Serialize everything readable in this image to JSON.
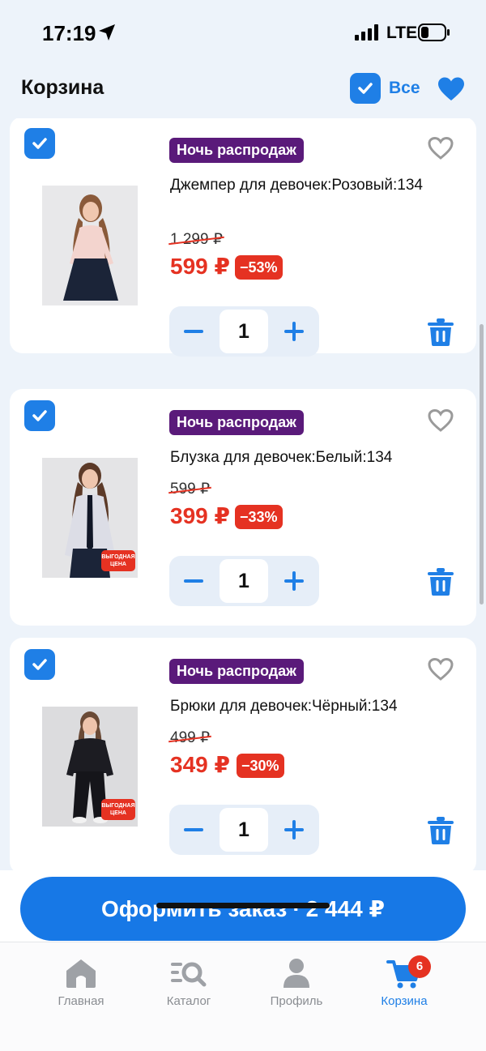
{
  "status_bar": {
    "time": "17:19",
    "network": "LTE"
  },
  "header": {
    "title": "Корзина",
    "select_all_label": "Все"
  },
  "items": [
    {
      "badge": "Ночь распродаж",
      "name": "Джемпер для девочек:Розовый:134",
      "old_price": "1 299 ₽",
      "price": "599 ₽",
      "discount": "−53%",
      "quantity": "1",
      "promo": ""
    },
    {
      "badge": "Ночь распродаж",
      "name": "Блузка для девочек:Белый:134",
      "old_price": "599 ₽",
      "price": "399 ₽",
      "discount": "−33%",
      "quantity": "1",
      "promo": "ВЫГОДНАЯ ЦЕНА"
    },
    {
      "badge": "Ночь распродаж",
      "name": "Брюки для девочек:Чёрный:134",
      "old_price": "499 ₽",
      "price": "349 ₽",
      "discount": "−30%",
      "quantity": "1",
      "promo": "ВЫГОДНАЯ ЦЕНА"
    }
  ],
  "checkout": {
    "label": "Оформить заказ",
    "separator": "·",
    "total": "2 444 ₽"
  },
  "tab_bar": {
    "tabs": [
      {
        "label": "Главная",
        "icon": "home-icon"
      },
      {
        "label": "Каталог",
        "icon": "catalog-search-icon"
      },
      {
        "label": "Профиль",
        "icon": "profile-icon"
      },
      {
        "label": "Корзина",
        "icon": "cart-icon",
        "badge": "6"
      }
    ],
    "active_tab": "Корзина"
  },
  "colors": {
    "accent": "#1f7fe6",
    "sale": "#e53222",
    "badge_purple": "#5a1a7a",
    "background": "#edf3fa"
  }
}
